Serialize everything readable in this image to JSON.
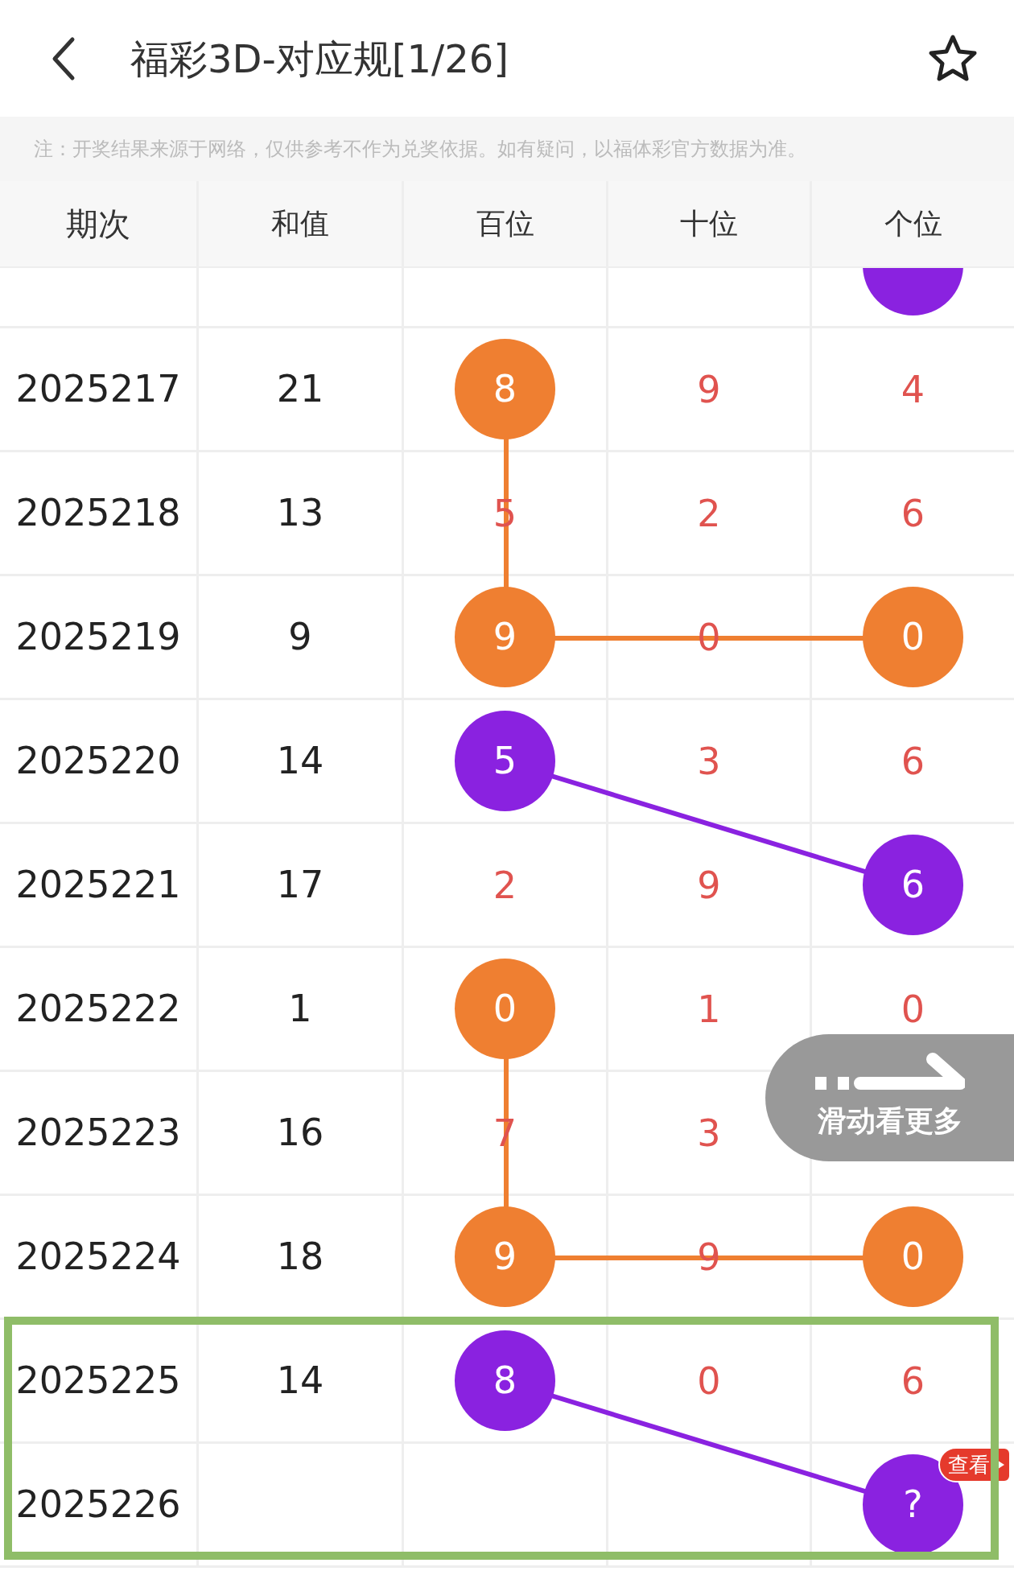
{
  "header": {
    "title": "福彩3D-对应规[1/26]",
    "favorited": false
  },
  "notice": "注：开奖结果来源于网络，仅供参考不作为兑奖依据。如有疑问，以福体彩官方数据为准。",
  "columns": [
    "期次",
    "和值",
    "百位",
    "十位",
    "个位"
  ],
  "rows": [
    {
      "highlighted": false,
      "digits": [
        {
          "kind": "blank"
        },
        {
          "kind": "blank"
        },
        {
          "kind": "ball",
          "color": "#8a22e0"
        }
      ]
    },
    {
      "issue": "2025217",
      "sum": "21",
      "highlighted": false,
      "digits": [
        {
          "kind": "ball",
          "value": "8",
          "color": "#ef7f31",
          "linked": false
        },
        {
          "kind": "digit",
          "value": "9"
        },
        {
          "kind": "digit",
          "value": "4"
        }
      ]
    },
    {
      "issue": "2025218",
      "sum": "13",
      "highlighted": false,
      "digits": [
        {
          "kind": "digit",
          "value": "5"
        },
        {
          "kind": "digit",
          "value": "2"
        },
        {
          "kind": "digit",
          "value": "6"
        }
      ]
    },
    {
      "issue": "2025219",
      "sum": "9",
      "highlighted": false,
      "digits": [
        {
          "kind": "ball",
          "value": "9",
          "color": "#ef7f31",
          "linked": true
        },
        {
          "kind": "digit",
          "value": "0"
        },
        {
          "kind": "ball",
          "value": "0",
          "color": "#ef7f31",
          "linked": true
        }
      ]
    },
    {
      "issue": "2025220",
      "sum": "14",
      "highlighted": false,
      "digits": [
        {
          "kind": "ball",
          "value": "5",
          "color": "#8a22e0",
          "linked": false
        },
        {
          "kind": "digit",
          "value": "3"
        },
        {
          "kind": "digit",
          "value": "6"
        }
      ]
    },
    {
      "issue": "2025221",
      "sum": "17",
      "highlighted": false,
      "digits": [
        {
          "kind": "digit",
          "value": "2"
        },
        {
          "kind": "digit",
          "value": "9"
        },
        {
          "kind": "ball",
          "value": "6",
          "color": "#8a22e0",
          "linked": true
        }
      ]
    },
    {
      "issue": "2025222",
      "sum": "1",
      "highlighted": false,
      "digits": [
        {
          "kind": "ball",
          "value": "0",
          "color": "#ef7f31",
          "linked": false
        },
        {
          "kind": "digit",
          "value": "1"
        },
        {
          "kind": "digit",
          "value": "0"
        }
      ]
    },
    {
      "issue": "2025223",
      "sum": "16",
      "highlighted": false,
      "digits": [
        {
          "kind": "digit",
          "value": "7"
        },
        {
          "kind": "digit",
          "value": "3"
        },
        {
          "kind": "blank"
        }
      ]
    },
    {
      "issue": "2025224",
      "sum": "18",
      "highlighted": false,
      "digits": [
        {
          "kind": "ball",
          "value": "9",
          "color": "#ef7f31",
          "linked": true
        },
        {
          "kind": "digit",
          "value": "9"
        },
        {
          "kind": "ball",
          "value": "0",
          "color": "#ef7f31",
          "linked": true
        }
      ]
    },
    {
      "issue": "2025225",
      "sum": "14",
      "highlighted": true,
      "digits": [
        {
          "kind": "ball",
          "value": "8",
          "color": "#8a22e0",
          "linked": false
        },
        {
          "kind": "digit",
          "value": "0"
        },
        {
          "kind": "digit",
          "value": "6"
        }
      ]
    },
    {
      "issue": "2025226",
      "highlighted": true,
      "digits": [
        {
          "kind": "blank"
        },
        {
          "kind": "blank"
        },
        {
          "kind": "ball",
          "value": "?",
          "color": "#8a22e0",
          "linked": true,
          "badge": "查看"
        }
      ]
    }
  ],
  "swipe_hint": "滑动看更多"
}
